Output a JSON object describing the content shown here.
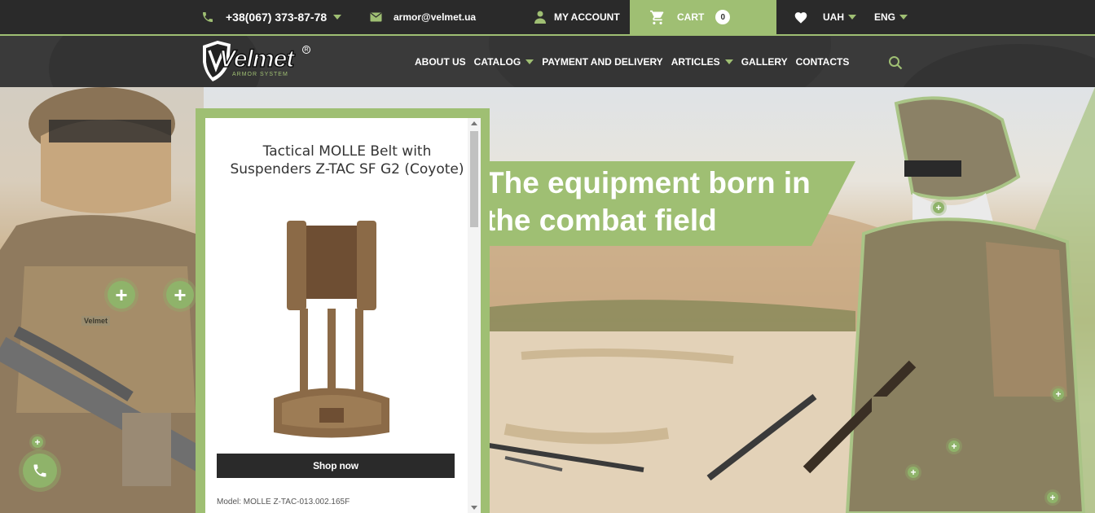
{
  "topbar": {
    "phone": "+38(067) 373-87-78",
    "email": "armor@velmet.ua",
    "account_label": "MY ACCOUNT",
    "cart_label": "CART",
    "cart_count": "0",
    "currency": "UAH",
    "language": "ENG"
  },
  "logo": {
    "brand": "Velmet",
    "tagline": "ARMOR SYSTEM"
  },
  "nav": {
    "items": [
      {
        "label": "ABOUT US"
      },
      {
        "label": "CATALOG"
      },
      {
        "label": "PAYMENT AND DELIVERY"
      },
      {
        "label": "ARTICLES"
      },
      {
        "label": "GALLERY"
      },
      {
        "label": "CONTACTS"
      }
    ]
  },
  "hero": {
    "headline_line1": "The equipment born in",
    "headline_line2": "the combat field",
    "patch_text": "Velmet"
  },
  "product_card": {
    "title": "Tactical MOLLE Belt with Suspenders Z-TAC SF G2 (Coyote)",
    "button_label": "Shop now",
    "model": "Model: MOLLE Z-TAC-013.002.165F"
  },
  "colors": {
    "accent": "#9fbf73",
    "dark": "#2a2a2a",
    "nav_bg": "#3a3a3a"
  }
}
